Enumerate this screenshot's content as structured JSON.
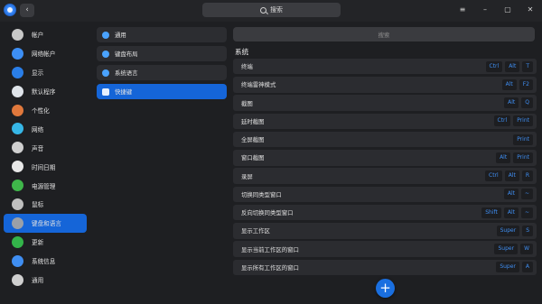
{
  "titlebar": {
    "search_label": "搜索",
    "back_glyph": "‹",
    "menu_glyph": "≡",
    "min_glyph": "–",
    "max_glyph": "▢",
    "close_glyph": "✕"
  },
  "sidebar": {
    "items": [
      {
        "label": "帐户",
        "icon": "account-icon",
        "color": "#c8c8c8",
        "active": false
      },
      {
        "label": "网络帐户",
        "icon": "cloud-icon",
        "color": "#3d8ff5",
        "active": false
      },
      {
        "label": "显示",
        "icon": "display-icon",
        "color": "#2a7ee8",
        "active": false
      },
      {
        "label": "默认程序",
        "icon": "default-apps-icon",
        "color": "#dfe4ea",
        "active": false
      },
      {
        "label": "个性化",
        "icon": "personalization-icon",
        "color": "#e0783c",
        "active": false
      },
      {
        "label": "网络",
        "icon": "network-icon",
        "color": "#36b6e6",
        "active": false
      },
      {
        "label": "声音",
        "icon": "sound-icon",
        "color": "#cfcfcf",
        "active": false
      },
      {
        "label": "时间日期",
        "icon": "clock-icon",
        "color": "#e8e8e8",
        "active": false
      },
      {
        "label": "电源管理",
        "icon": "power-icon",
        "color": "#3fb64a",
        "active": false
      },
      {
        "label": "鼠标",
        "icon": "mouse-icon",
        "color": "#bfbfbf",
        "active": false
      },
      {
        "label": "键盘和语言",
        "icon": "keyboard-icon",
        "color": "#9aa0a8",
        "active": true
      },
      {
        "label": "更新",
        "icon": "update-icon",
        "color": "#33b44a",
        "active": false
      },
      {
        "label": "系统信息",
        "icon": "system-info-icon",
        "color": "#3f8ef2",
        "active": false
      },
      {
        "label": "通用",
        "icon": "general-icon",
        "color": "#cfcfcf",
        "active": false
      }
    ]
  },
  "middle": {
    "items": [
      {
        "label": "通用",
        "active": false
      },
      {
        "label": "键盘布局",
        "active": false
      },
      {
        "label": "系统语言",
        "active": false
      },
      {
        "label": "快捷键",
        "active": true
      }
    ]
  },
  "right": {
    "search_placeholder": "搜索",
    "section_title": "系统",
    "shortcuts": [
      {
        "label": "终端",
        "keys": [
          "Ctrl",
          "Alt",
          "T"
        ]
      },
      {
        "label": "终端雷神模式",
        "keys": [
          "Alt",
          "F2"
        ]
      },
      {
        "label": "截图",
        "keys": [
          "Alt",
          "Q"
        ]
      },
      {
        "label": "延时截图",
        "keys": [
          "Ctrl",
          "Print"
        ]
      },
      {
        "label": "全屏截图",
        "keys": [
          "Print"
        ]
      },
      {
        "label": "窗口截图",
        "keys": [
          "Alt",
          "Print"
        ]
      },
      {
        "label": "录屏",
        "keys": [
          "Ctrl",
          "Alt",
          "R"
        ]
      },
      {
        "label": "切换同类型窗口",
        "keys": [
          "Alt",
          "~"
        ]
      },
      {
        "label": "反向切换同类型窗口",
        "keys": [
          "Shift",
          "Alt",
          "~"
        ]
      },
      {
        "label": "显示工作区",
        "keys": [
          "Super",
          "S"
        ]
      },
      {
        "label": "显示当前工作区的窗口",
        "keys": [
          "Super",
          "W"
        ]
      },
      {
        "label": "显示所有工作区的窗口",
        "keys": [
          "Super",
          "A"
        ]
      }
    ],
    "add_glyph": "+"
  }
}
